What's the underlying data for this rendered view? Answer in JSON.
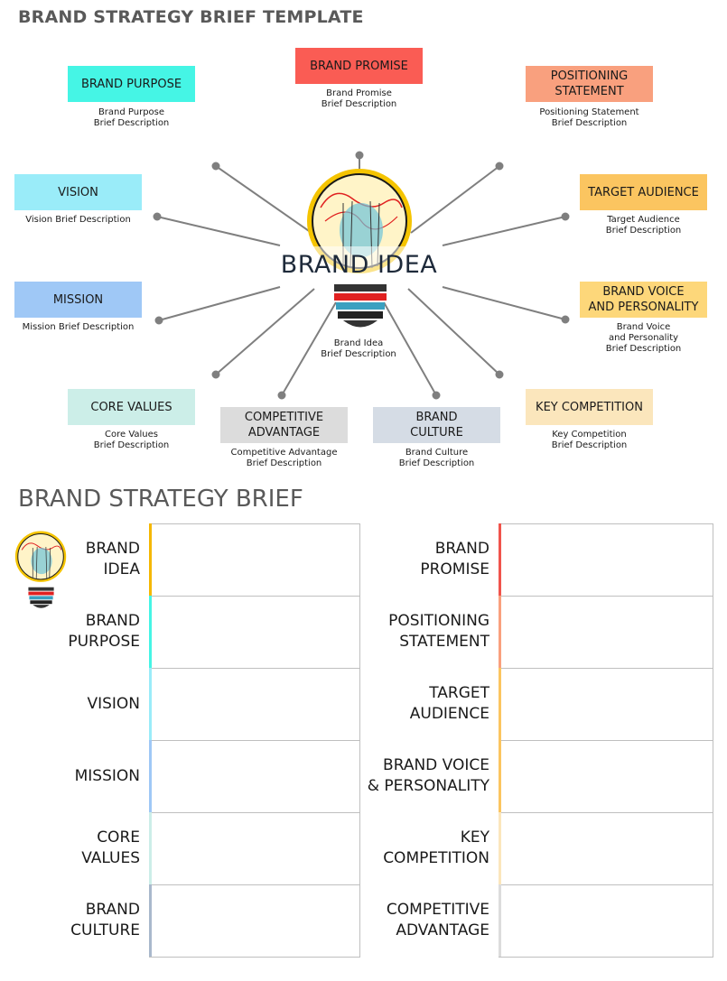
{
  "header": {
    "title": "BRAND STRATEGY BRIEF TEMPLATE"
  },
  "diagram": {
    "center": {
      "label": "BRAND IDEA",
      "desc_line1": "Brand Idea",
      "desc_line2": "Brief Description"
    },
    "nodes": {
      "brand_purpose": {
        "label": "BRAND PURPOSE",
        "color": "#45F5E5",
        "desc_line1": "Brand Purpose",
        "desc_line2": "Brief Description"
      },
      "brand_promise": {
        "label": "BRAND PROMISE",
        "color": "#FA5C54",
        "desc_line1": "Brand Promise",
        "desc_line2": "Brief Description"
      },
      "positioning_statement": {
        "label_line1": "POSITIONING",
        "label_line2": "STATEMENT",
        "color": "#F9A07E",
        "desc_line1": "Positioning Statement",
        "desc_line2": "Brief Description"
      },
      "vision": {
        "label": "VISION",
        "color": "#9AECF9",
        "desc_line1": "Vision Brief Description"
      },
      "target_audience": {
        "label": "TARGET AUDIENCE",
        "color": "#FBC560",
        "desc_line1": "Target Audience",
        "desc_line2": "Brief Description"
      },
      "mission": {
        "label": "MISSION",
        "color": "#9FC8F6",
        "desc_line1": "Mission Brief Description"
      },
      "brand_voice": {
        "label_line1": "BRAND VOICE",
        "label_line2": "AND PERSONALITY",
        "color": "#FDD77A",
        "desc_line1": "Brand Voice",
        "desc_line2": "and Personality",
        "desc_line3": "Brief Description"
      },
      "core_values": {
        "label": "CORE VALUES",
        "color": "#CCEEE8",
        "desc_line1": "Core Values",
        "desc_line2": "Brief Description"
      },
      "competitive_advantage": {
        "label_line1": "COMPETITIVE",
        "label_line2": "ADVANTAGE",
        "color": "#DCDCDC",
        "desc_line1": "Competitive Advantage",
        "desc_line2": "Brief Description"
      },
      "brand_culture": {
        "label_line1": "BRAND",
        "label_line2": "CULTURE",
        "color": "#D5DCE5",
        "desc_line1": "Brand Culture",
        "desc_line2": "Brief Description"
      },
      "key_competition": {
        "label": "KEY COMPETITION",
        "color": "#FBE6BC",
        "desc_line1": "Key Competition",
        "desc_line2": "Brief Description"
      }
    },
    "connector_color": "#7F7F7F"
  },
  "brief": {
    "title": "BRAND STRATEGY BRIEF",
    "left_rows": [
      {
        "line1": "BRAND",
        "line2": "IDEA",
        "accent": "#F5B700",
        "value": ""
      },
      {
        "line1": "BRAND",
        "line2": "PURPOSE",
        "accent": "#45F5E5",
        "value": ""
      },
      {
        "line1": "VISION",
        "line2": "",
        "accent": "#9AECF9",
        "value": ""
      },
      {
        "line1": "MISSION",
        "line2": "",
        "accent": "#9FC8F6",
        "value": ""
      },
      {
        "line1": "CORE",
        "line2": "VALUES",
        "accent": "#CCEEE8",
        "value": ""
      },
      {
        "line1": "BRAND",
        "line2": "CULTURE",
        "accent": "#A9B8CC",
        "value": ""
      }
    ],
    "right_rows": [
      {
        "line1": "BRAND",
        "line2": "PROMISE",
        "accent": "#F0544C",
        "value": ""
      },
      {
        "line1": "POSITIONING",
        "line2": "STATEMENT",
        "accent": "#F9A07E",
        "value": ""
      },
      {
        "line1": "TARGET",
        "line2": "AUDIENCE",
        "accent": "#FBC560",
        "value": ""
      },
      {
        "line1": "BRAND VOICE",
        "line2": "& PERSONALITY",
        "accent": "#FBC560",
        "value": ""
      },
      {
        "line1": "KEY",
        "line2": "COMPETITION",
        "accent": "#FBE6BC",
        "value": ""
      },
      {
        "line1": "COMPETITIVE",
        "line2": "ADVANTAGE",
        "accent": "#DCDCDC",
        "value": ""
      }
    ]
  }
}
